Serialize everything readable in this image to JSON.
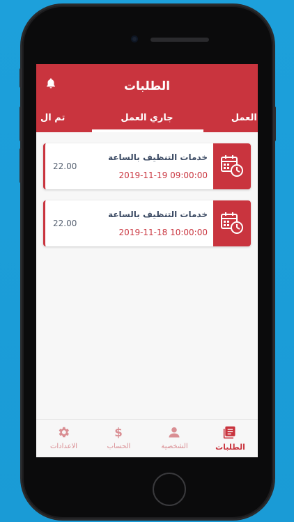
{
  "header": {
    "title": "الطلبات"
  },
  "tabs": [
    {
      "label": "تم ال",
      "position": "left-partial"
    },
    {
      "label": "جاري العمل",
      "active": true
    },
    {
      "label": "ء العمل",
      "position": "right-partial"
    }
  ],
  "orders": [
    {
      "service": "خدمات التنظيف بالساعة",
      "datetime": "2019-11-19 09:00:00",
      "price": "22.00"
    },
    {
      "service": "خدمات التنظيف بالساعة",
      "datetime": "2019-11-18 10:00:00",
      "price": "22.00"
    }
  ],
  "bottom_nav": [
    {
      "label": "الاعدادات",
      "icon": "gear-icon"
    },
    {
      "label": "الحساب",
      "icon": "dollar-icon"
    },
    {
      "label": "الشخصية",
      "icon": "person-icon"
    },
    {
      "label": "الطلبات",
      "icon": "orders-icon",
      "active": true
    }
  ],
  "colors": {
    "accent": "#c9343e",
    "background": "#1da0db",
    "text_dark": "#3b4a63"
  }
}
